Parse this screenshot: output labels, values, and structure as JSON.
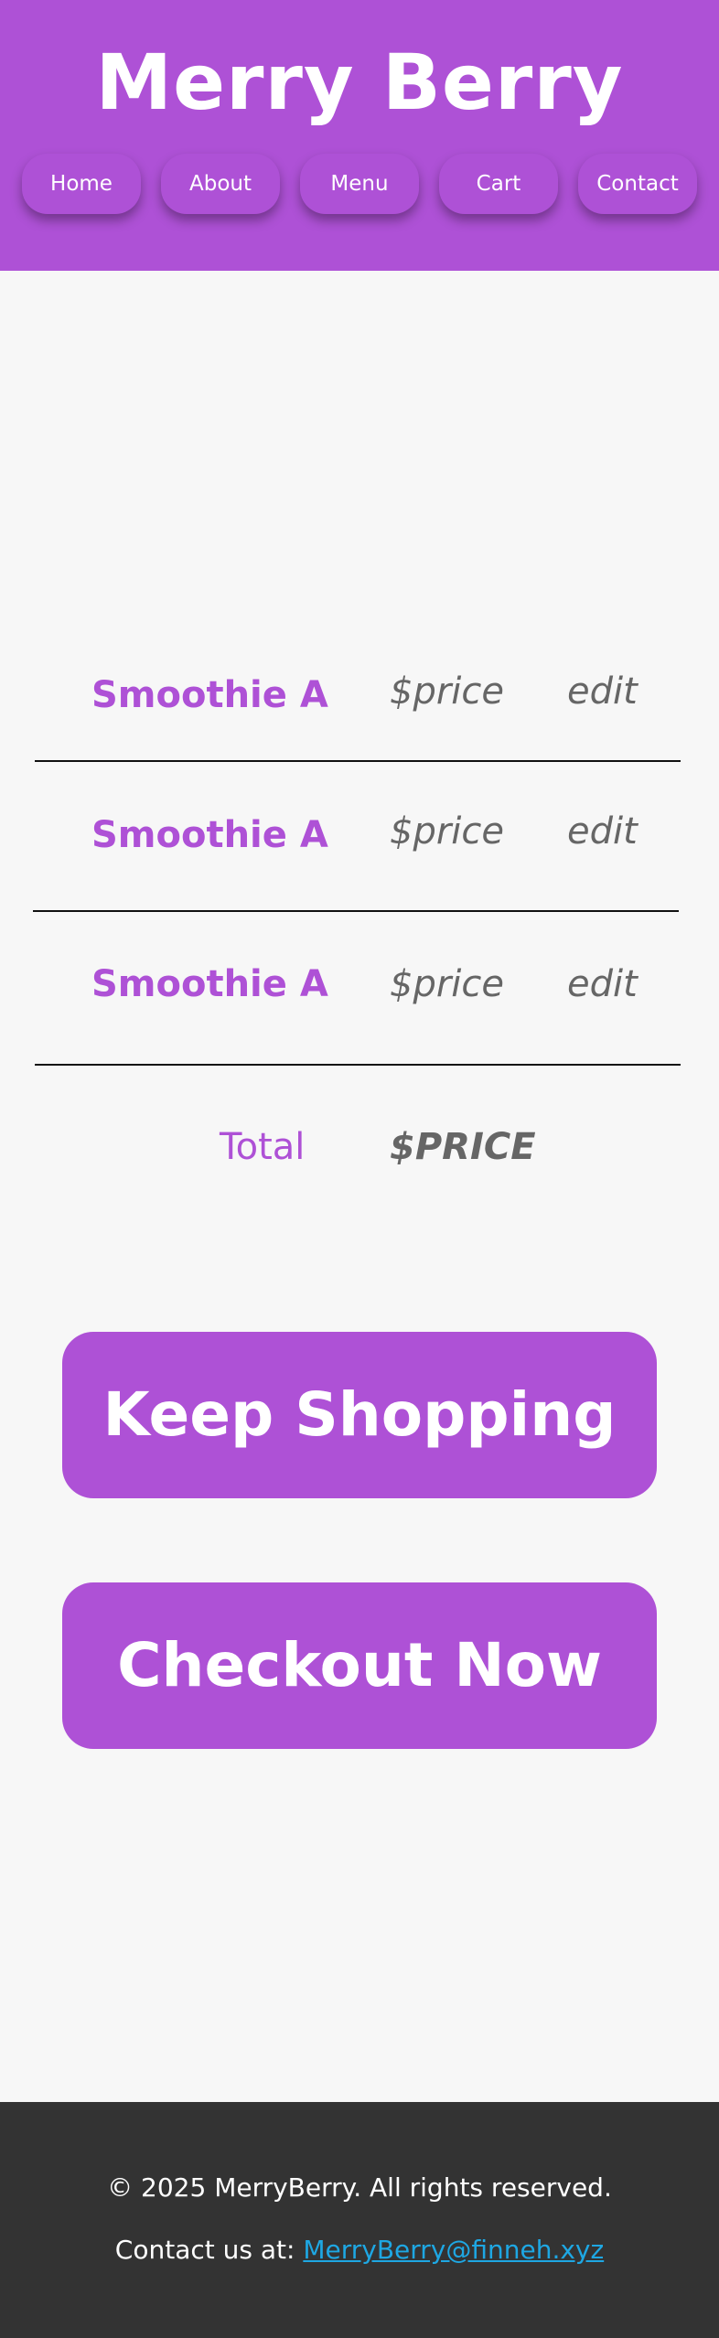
{
  "header": {
    "title": "Merry Berry",
    "nav": [
      {
        "label": "Home"
      },
      {
        "label": "About"
      },
      {
        "label": "Menu"
      },
      {
        "label": "Cart"
      },
      {
        "label": "Contact"
      }
    ]
  },
  "cart": {
    "items": [
      {
        "name": "Smoothie A",
        "price": "$price",
        "edit": "edit"
      },
      {
        "name": "Smoothie A",
        "price": "$price",
        "edit": "edit"
      },
      {
        "name": "Smoothie A",
        "price": "$price",
        "edit": "edit"
      }
    ],
    "total_label": "Total",
    "total_value": "$PRICE"
  },
  "actions": {
    "keep_shopping": "Keep Shopping",
    "checkout": "Checkout Now"
  },
  "footer": {
    "copyright": "© 2025 MerryBerry. All rights reserved.",
    "contact_prefix": "Contact us at: ",
    "contact_email": "MerryBerry@finneh.xyz"
  },
  "colors": {
    "brand": "#ae51d6",
    "background": "#f7f7f7",
    "muted_text": "#666666",
    "footer_bg": "#333333",
    "link": "#1ea7e3"
  }
}
